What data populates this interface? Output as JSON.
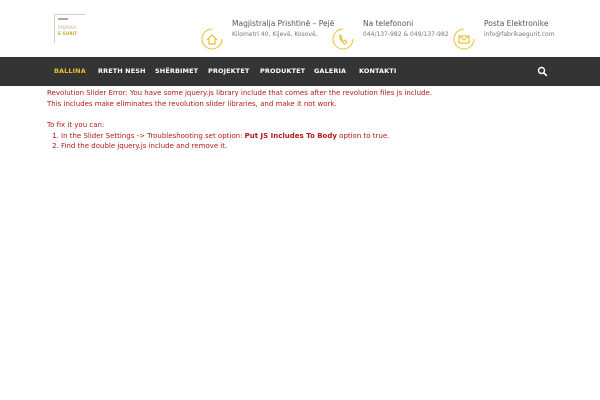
{
  "logo": {
    "line1": "FABRIKA",
    "line2": "E GURIT"
  },
  "contacts": [
    {
      "icon": "home-icon",
      "title": "Magjistralja Prishtinë – Pejë",
      "subtitle": "Kilometri 40, Kijevë, Kosovë."
    },
    {
      "icon": "phone-icon",
      "title": "Na telefononi",
      "subtitle": "044/137-982 & 049/137-982"
    },
    {
      "icon": "mail-icon",
      "title": "Posta Elektronike",
      "subtitle": "info@fabrikaegurit.com"
    }
  ],
  "nav": {
    "items": [
      "BALLINA",
      "RRETH NESH",
      "SHËRBIMET",
      "PROJEKTET",
      "PRODUKTET",
      "GALERIA",
      "KONTAKTI"
    ],
    "active_index": 0
  },
  "error": {
    "line1": "Revolution Slider Error: You have some jquery.js library include that comes after the revolution files js include.",
    "line2": "This includes make eliminates the revolution slider libraries, and make it not work.",
    "fix_intro": "To fix it you can:",
    "step1_pre": "In the Slider Settings -> Troubleshooting set option: ",
    "step1_bold": "Put JS Includes To Body",
    "step1_post": " option to true.",
    "step2": "Find the double jquery.js include and remove it."
  },
  "colors": {
    "accent": "#e8c02d",
    "navbar": "#343434",
    "error_text": "#b01a1a"
  }
}
